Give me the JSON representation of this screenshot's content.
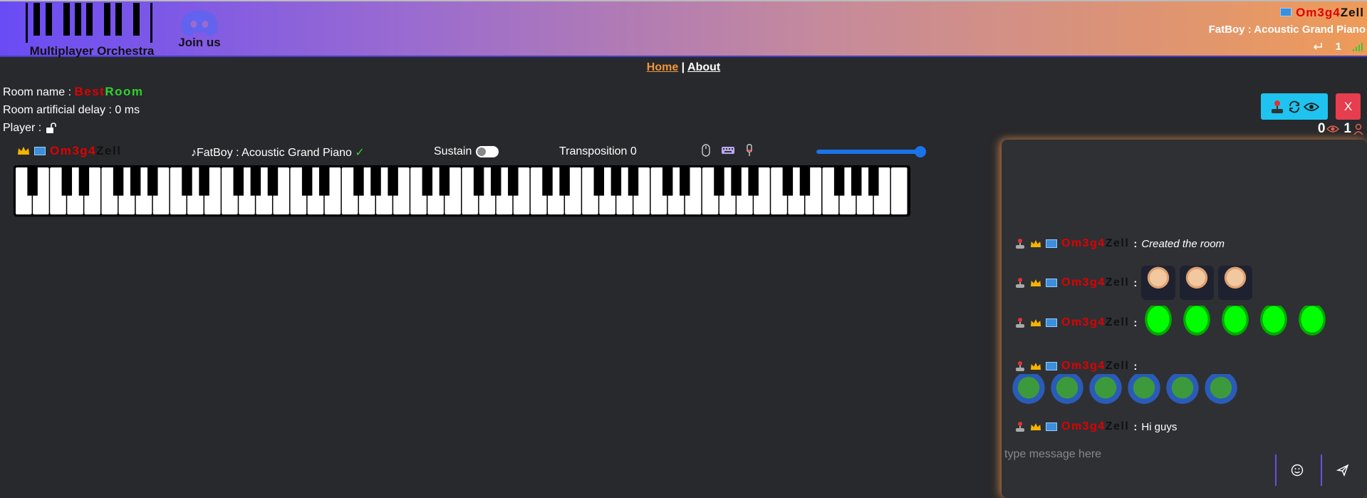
{
  "header": {
    "logo_text": "Multiplayer Orchestra",
    "discord_text": "Join us",
    "user": {
      "name_part1": "Om3g4",
      "name_part2": "Zell"
    },
    "instrument": "FatBoy : Acoustic Grand Piano",
    "ping": "1"
  },
  "nav": {
    "home": "Home",
    "separator": "|",
    "about": "About"
  },
  "room": {
    "name_label": "Room name :",
    "name_part1": "Best",
    "name_part2": "Room",
    "delay_label": "Room artificial delay : 0 ms",
    "player_label": "Player :"
  },
  "controls": {
    "close_label": "X",
    "spectators_count": "0",
    "players_count": "1"
  },
  "player_bar": {
    "user_part1": "Om3g4",
    "user_part2": "Zell",
    "instrument": "FatBoy : Acoustic Grand Piano",
    "check": "✓",
    "sustain_label": "Sustain",
    "sustain_on": false,
    "transposition": "Transposition 0",
    "volume_fraction": 1.0
  },
  "piano": {
    "white_keys": 52
  },
  "chat": {
    "messages": [
      {
        "user1": "Om3g4",
        "user2": "Zell",
        "sep": ":",
        "text": "Created the room"
      },
      {
        "user1": "Om3g4",
        "user2": "Zell",
        "sep": ":",
        "emotes": [
          "trump",
          "trump",
          "trump"
        ]
      },
      {
        "user1": "Om3g4",
        "user2": "Zell",
        "sep": ":",
        "emotes": [
          "parrot",
          "parrot",
          "parrot",
          "parrot",
          "parrot"
        ]
      },
      {
        "user1": "Om3g4",
        "user2": "Zell",
        "sep": ":",
        "emotes": [
          "pepe",
          "pepe",
          "pepe",
          "pepe",
          "pepe",
          "pepe"
        ]
      },
      {
        "user1": "Om3g4",
        "user2": "Zell",
        "sep": ":",
        "text": "Hi guys"
      }
    ],
    "input_placeholder": "type message here"
  },
  "colors": {
    "accent": "#1ec4ef",
    "danger": "#e63d4f",
    "home_link": "#f0953e"
  }
}
